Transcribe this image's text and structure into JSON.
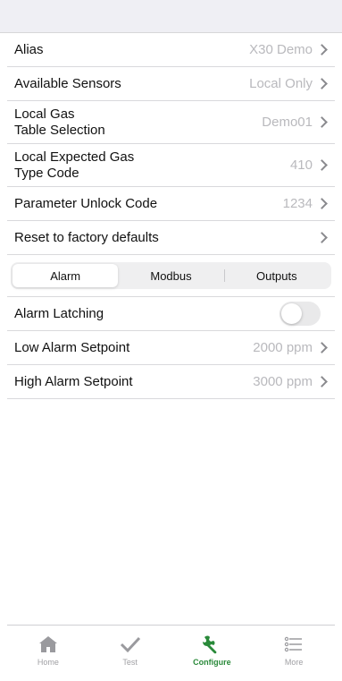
{
  "rows_top": [
    {
      "label": "Alias",
      "value": "X30 Demo"
    },
    {
      "label": "Available Sensors",
      "value": "Local Only"
    },
    {
      "label": "Local Gas\nTable Selection",
      "value": "Demo01"
    },
    {
      "label": "Local Expected Gas\nType Code",
      "value": "410"
    },
    {
      "label": "Parameter Unlock Code",
      "value": "1234"
    },
    {
      "label": "Reset to factory defaults",
      "value": ""
    }
  ],
  "segments": [
    "Alarm",
    "Modbus",
    "Outputs"
  ],
  "selected_segment": "Alarm",
  "alarm_latching": {
    "label": "Alarm Latching",
    "enabled": false
  },
  "rows_bottom": [
    {
      "label": "Low Alarm Setpoint",
      "value": "2000 ppm"
    },
    {
      "label": "High Alarm Setpoint",
      "value": "3000 ppm"
    }
  ],
  "tabbar": [
    {
      "label": "Home",
      "icon": "home-icon"
    },
    {
      "label": "Test",
      "icon": "checkmark-icon"
    },
    {
      "label": "Configure",
      "icon": "wrench-icon"
    },
    {
      "label": "More",
      "icon": "list-icon"
    }
  ],
  "active_tab": "Configure",
  "colors": {
    "accent": "#2a8a3a",
    "value_gray": "#b9b9bd"
  }
}
